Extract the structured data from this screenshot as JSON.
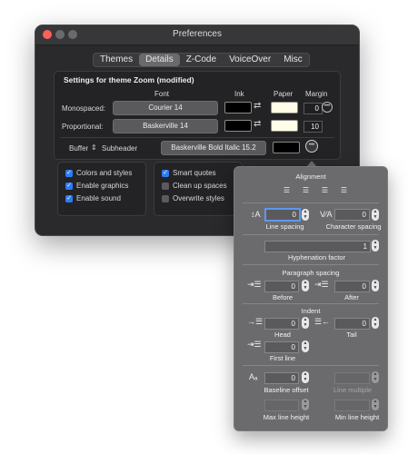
{
  "window": {
    "title": "Preferences"
  },
  "tabs": [
    "Themes",
    "Details",
    "Z-Code",
    "VoiceOver",
    "Misc"
  ],
  "settings": {
    "heading": "Settings for theme Zoom (modified)",
    "col_font": "Font",
    "col_ink": "Ink",
    "col_paper": "Paper",
    "col_margin": "Margin",
    "mono_label": "Monospaced:",
    "mono_font": "Courier 14",
    "mono_margin": "0",
    "prop_label": "Proportional:",
    "prop_font": "Baskerville 14",
    "prop_margin": "10",
    "buffer_label": "Buffer",
    "style_select": "Subheader",
    "style_font": "Baskerville Bold Italic 15.2"
  },
  "options": {
    "left": [
      {
        "label": "Colors and styles",
        "checked": true
      },
      {
        "label": "Enable graphics",
        "checked": true
      },
      {
        "label": "Enable sound",
        "checked": true
      }
    ],
    "middle": [
      {
        "label": "Smart quotes",
        "checked": true
      },
      {
        "label": "Clean up spaces",
        "checked": false
      },
      {
        "label": "Overwrite styles",
        "checked": false
      }
    ]
  },
  "popover": {
    "alignment": "Alignment",
    "line_spacing_value": "0",
    "line_spacing": "Line spacing",
    "char_spacing_value": "0",
    "char_spacing": "Character spacing",
    "hyphenation_value": "1",
    "hyphenation": "Hyphenation factor",
    "para_spacing": "Paragraph spacing",
    "before_value": "0",
    "before": "Before",
    "after_value": "0",
    "after": "After",
    "indent": "Indent",
    "head_value": "0",
    "head": "Head",
    "tail_value": "0",
    "tail": "Tail",
    "first_line_value": "0",
    "first_line": "First line",
    "baseline_value": "0",
    "baseline": "Baseline offset",
    "line_multiple": "Line multiple",
    "max_line_height": "Max line height",
    "min_line_height": "Min line height"
  },
  "colors": {
    "accent": "#2f7bf6",
    "paper": "#fffde8",
    "ink": "#000000"
  }
}
